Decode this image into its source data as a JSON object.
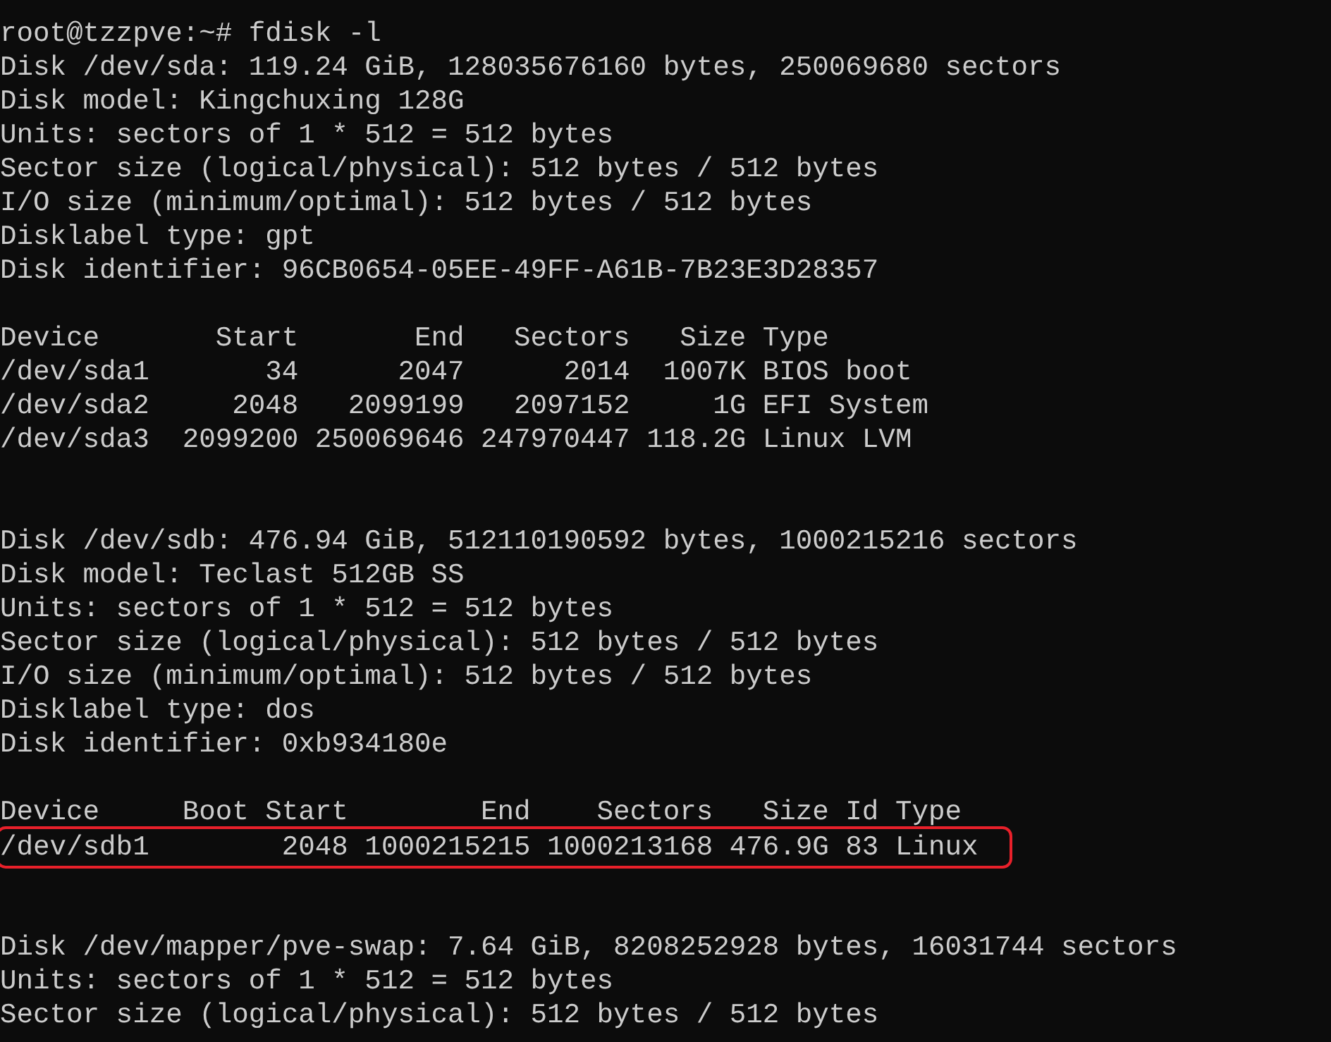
{
  "terminal": {
    "lines": [
      {
        "kind": "text",
        "text": "root@tzzpve:~# fdisk -l"
      },
      {
        "kind": "text",
        "text": "Disk /dev/sda: 119.24 GiB, 128035676160 bytes, 250069680 sectors"
      },
      {
        "kind": "text",
        "text": "Disk model: Kingchuxing 128G"
      },
      {
        "kind": "text",
        "text": "Units: sectors of 1 * 512 = 512 bytes"
      },
      {
        "kind": "text",
        "text": "Sector size (logical/physical): 512 bytes / 512 bytes"
      },
      {
        "kind": "text",
        "text": "I/O size (minimum/optimal): 512 bytes / 512 bytes"
      },
      {
        "kind": "text",
        "text": "Disklabel type: gpt"
      },
      {
        "kind": "text",
        "text": "Disk identifier: 96CB0654-05EE-49FF-A61B-7B23E3D28357"
      },
      {
        "kind": "blank"
      },
      {
        "kind": "text",
        "text": "Device       Start       End   Sectors   Size Type"
      },
      {
        "kind": "text",
        "text": "/dev/sda1       34      2047      2014  1007K BIOS boot"
      },
      {
        "kind": "text",
        "text": "/dev/sda2     2048   2099199   2097152     1G EFI System"
      },
      {
        "kind": "text",
        "text": "/dev/sda3  2099200 250069646 247970447 118.2G Linux LVM"
      },
      {
        "kind": "blank"
      },
      {
        "kind": "blank"
      },
      {
        "kind": "text",
        "text": "Disk /dev/sdb: 476.94 GiB, 512110190592 bytes, 1000215216 sectors"
      },
      {
        "kind": "text",
        "text": "Disk model: Teclast 512GB SS"
      },
      {
        "kind": "text",
        "text": "Units: sectors of 1 * 512 = 512 bytes"
      },
      {
        "kind": "text",
        "text": "Sector size (logical/physical): 512 bytes / 512 bytes"
      },
      {
        "kind": "text",
        "text": "I/O size (minimum/optimal): 512 bytes / 512 bytes"
      },
      {
        "kind": "text",
        "text": "Disklabel type: dos"
      },
      {
        "kind": "text",
        "text": "Disk identifier: 0xb934180e"
      },
      {
        "kind": "blank"
      },
      {
        "kind": "text",
        "text": "Device     Boot Start        End    Sectors   Size Id Type"
      },
      {
        "kind": "highlighted",
        "text": "/dev/sdb1        2048 1000215215 1000213168 476.9G 83 Linux"
      },
      {
        "kind": "blank"
      },
      {
        "kind": "blank"
      },
      {
        "kind": "text",
        "text": "Disk /dev/mapper/pve-swap: 7.64 GiB, 8208252928 bytes, 16031744 sectors"
      },
      {
        "kind": "text",
        "text": "Units: sectors of 1 * 512 = 512 bytes"
      },
      {
        "kind": "text",
        "text": "Sector size (logical/physical): 512 bytes / 512 bytes"
      }
    ]
  }
}
